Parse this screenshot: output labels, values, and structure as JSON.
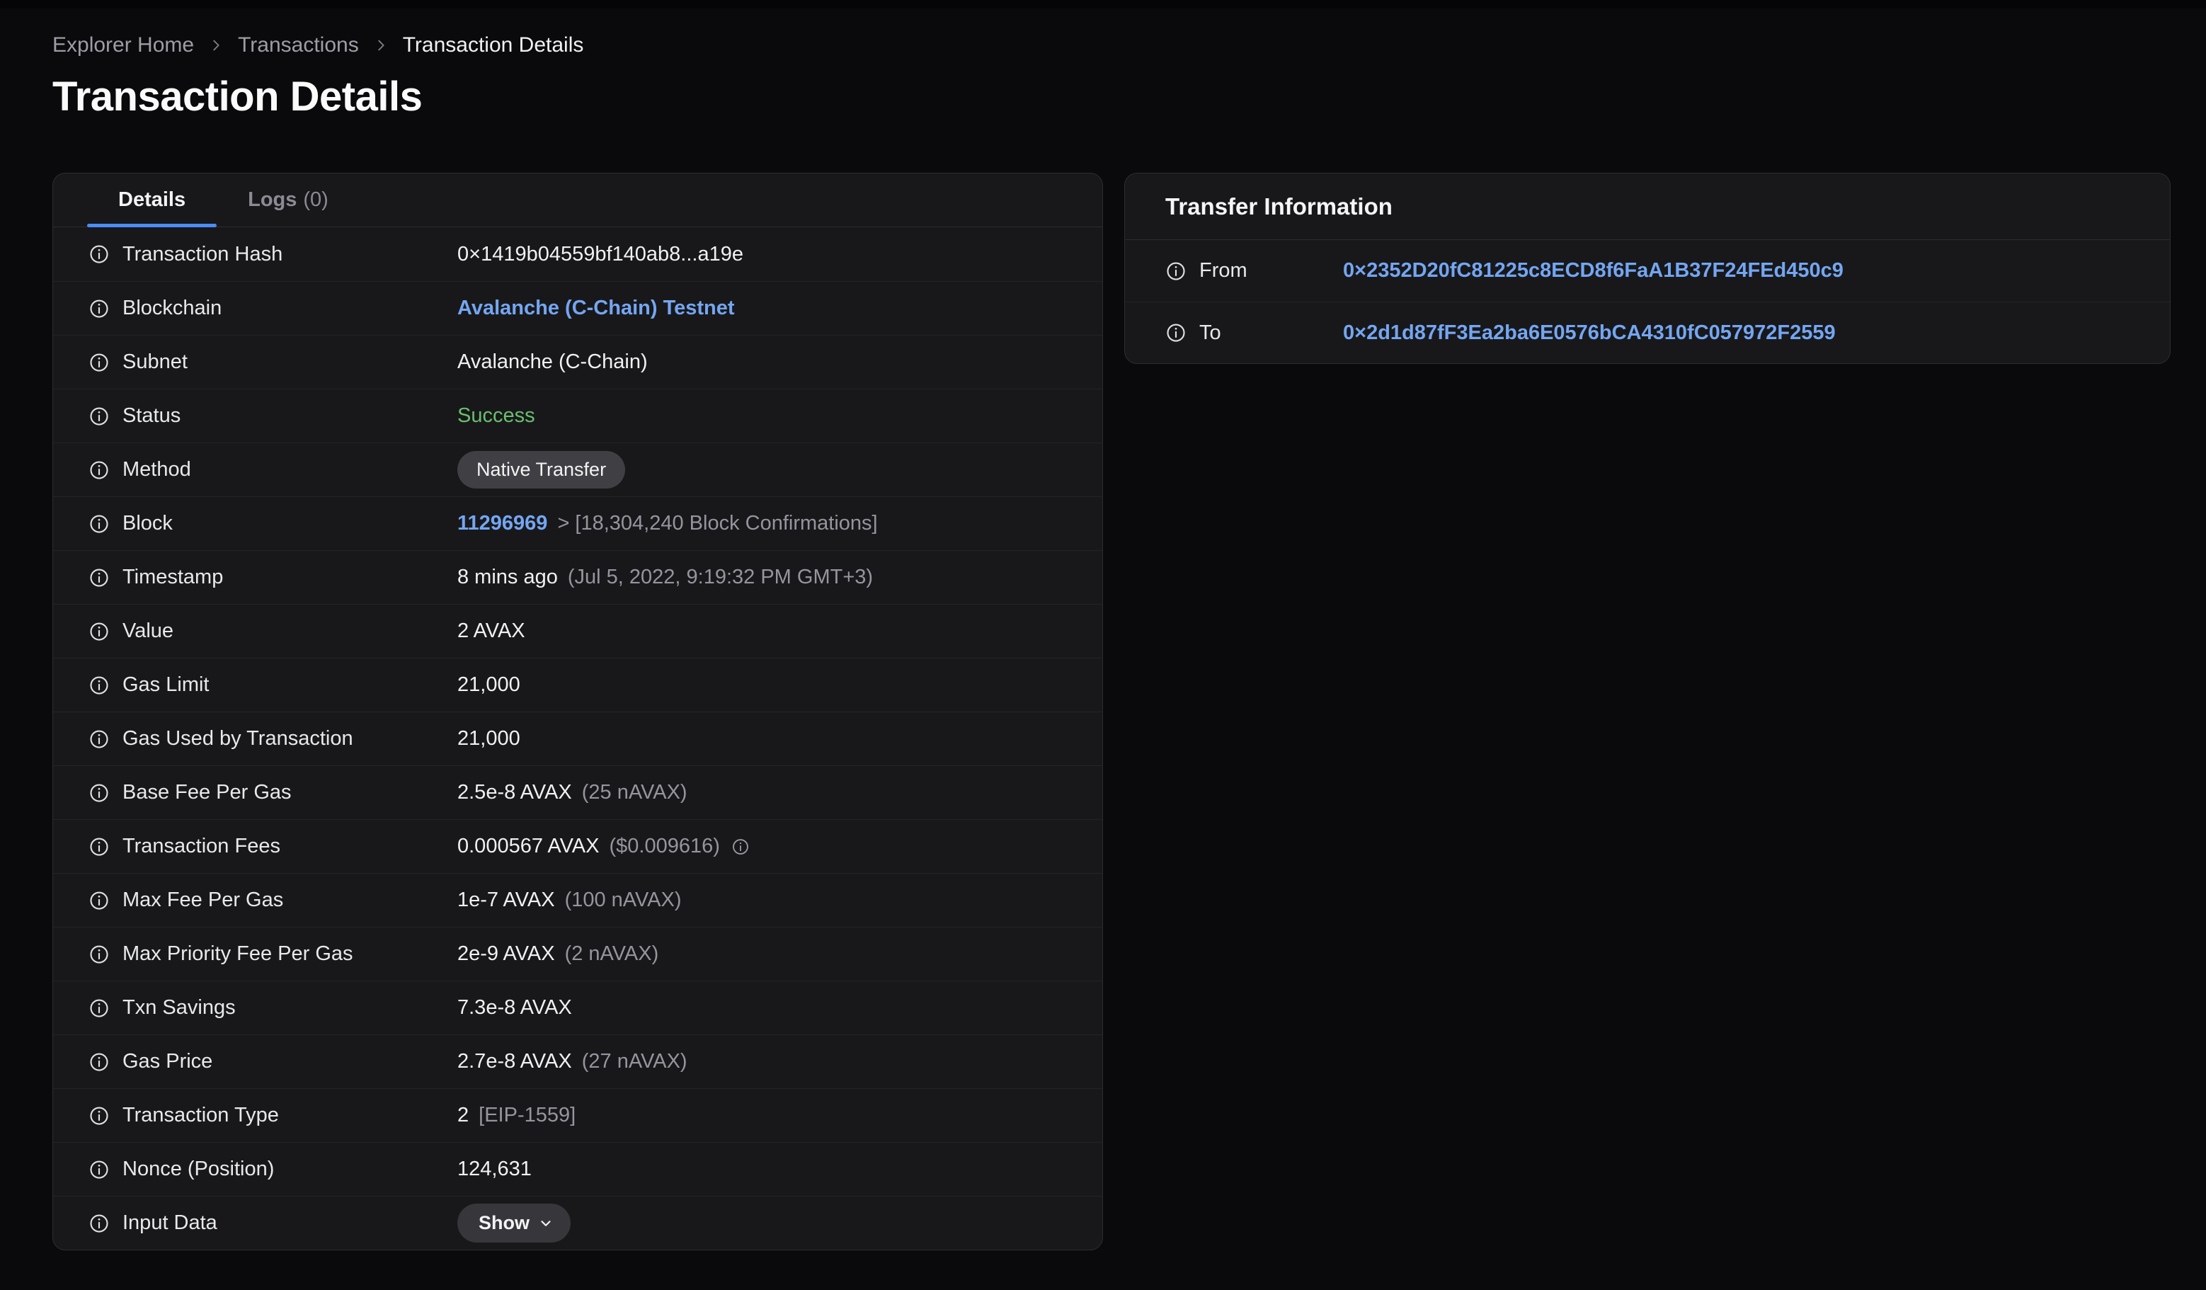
{
  "breadcrumb": {
    "items": [
      {
        "label": "Explorer Home"
      },
      {
        "label": "Transactions"
      },
      {
        "label": "Transaction Details",
        "current": true
      }
    ]
  },
  "title": "Transaction Details",
  "colors": {
    "page_bg": "#0a0a0c",
    "card_bg": "#18181b",
    "accent_blue": "#4b8cf5",
    "link_blue": "#74a6f1",
    "success_green": "#6abf6e"
  },
  "details_card": {
    "tabs": [
      {
        "label": "Details",
        "active": true
      },
      {
        "label": "Logs",
        "count": "(0)"
      }
    ],
    "rows": [
      {
        "label": "Transaction Hash",
        "value": "0×1419b04559bf140ab8...a19e"
      },
      {
        "label": "Blockchain",
        "value": "Avalanche (C-Chain) Testnet",
        "type": "link"
      },
      {
        "label": "Subnet",
        "value": "Avalanche (C-Chain)"
      },
      {
        "label": "Status",
        "value": "Success",
        "type": "success"
      },
      {
        "label": "Method",
        "value": "Native Transfer",
        "type": "badge"
      },
      {
        "label": "Block",
        "value": "11296969",
        "suffix": "> [18,304,240 Block Confirmations]",
        "type": "link"
      },
      {
        "label": "Timestamp",
        "value": "8 mins ago",
        "suffix": "(Jul 5, 2022, 9:19:32 PM GMT+3)"
      },
      {
        "label": "Value",
        "value": "2 AVAX"
      },
      {
        "label": "Gas Limit",
        "value": "21,000"
      },
      {
        "label": "Gas Used by Transaction",
        "value": "21,000"
      },
      {
        "label": "Base Fee Per Gas",
        "value": "2.5e-8 AVAX",
        "suffix": "(25 nAVAX)"
      },
      {
        "label": "Transaction Fees",
        "value": "0.000567 AVAX",
        "suffix": "($0.009616)",
        "info_icon": true
      },
      {
        "label": "Max Fee Per Gas",
        "value": "1e-7 AVAX",
        "suffix": "(100 nAVAX)"
      },
      {
        "label": "Max Priority Fee Per Gas",
        "value": "2e-9 AVAX",
        "suffix": "(2 nAVAX)"
      },
      {
        "label": "Txn Savings",
        "value": "7.3e-8 AVAX"
      },
      {
        "label": "Gas Price",
        "value": "2.7e-8 AVAX",
        "suffix": "(27 nAVAX)"
      },
      {
        "label": "Transaction Type",
        "value": "2",
        "suffix": "[EIP-1559]"
      },
      {
        "label": "Nonce (Position)",
        "value": "124,631"
      },
      {
        "label": "Input Data",
        "value": "Show",
        "type": "button"
      }
    ]
  },
  "transfer_card": {
    "title": "Transfer Information",
    "rows": [
      {
        "label": "From",
        "value": "0×2352D20fC81225c8ECD8f6FaA1B37F24FEd450c9",
        "type": "address"
      },
      {
        "label": "To",
        "value": "0×2d1d87fF3Ea2ba6E0576bCA4310fC057972F2559",
        "type": "address"
      }
    ]
  }
}
